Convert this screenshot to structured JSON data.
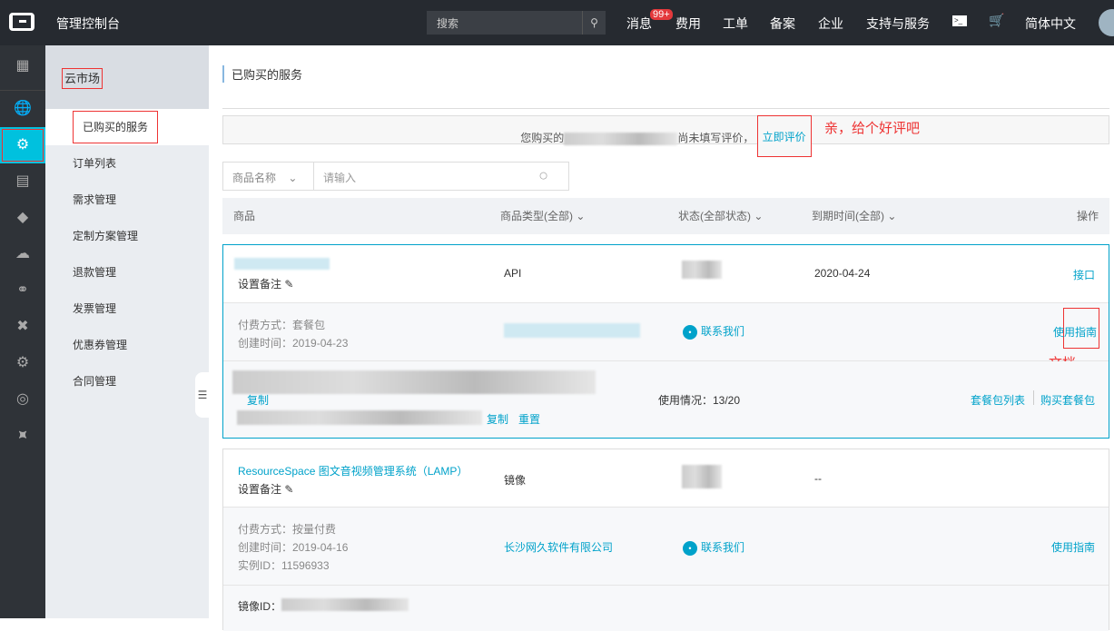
{
  "topbar": {
    "title": "管理控制台",
    "search_placeholder": "搜索",
    "badge": "99+",
    "nav": [
      "消息",
      "费用",
      "工单",
      "备案",
      "企业",
      "支持与服务",
      "简体中文"
    ],
    "terminal": ">_"
  },
  "sidebar": {
    "heading": "云市场",
    "items": [
      "已购买的服务",
      "订单列表",
      "需求管理",
      "定制方案管理",
      "退款管理",
      "发票管理",
      "优惠券管理",
      "合同管理"
    ]
  },
  "main": {
    "title": "已购买的服务",
    "notice": {
      "prefix": "您购买的",
      "suffix": "尚未填写评价，",
      "link": "立即评价",
      "annotation": "亲，给个好评吧"
    },
    "filter": {
      "select": "商品名称",
      "placeholder": "请输入"
    },
    "columns": [
      "商品",
      "商品类型(全部)",
      "状态(全部状态)",
      "到期时间(全部)",
      "操作"
    ],
    "items": [
      {
        "remark": "设置备注",
        "type": "API",
        "expire": "2020-04-24",
        "action": "接口",
        "pay": "付费方式：套餐包",
        "created": "创建时间：2019-04-23",
        "contact": "联系我们",
        "guide": "使用指南",
        "annotation": "文档",
        "copy1": "复制",
        "copy2": "复制",
        "reset": "重置",
        "usage": "使用情况：13/20",
        "pkg_list": "套餐包列表",
        "buy_pkg": "购买套餐包"
      },
      {
        "name": "ResourceSpace 图文音视频管理系统（LAMP）",
        "remark": "设置备注",
        "type": "镜像",
        "expire": "--",
        "pay": "付费方式：按量付费",
        "created": "创建时间：2019-04-16",
        "instance": "实例ID：11596933",
        "vendor": "长沙网久软件有限公司",
        "contact": "联系我们",
        "guide": "使用指南",
        "image_id": "镜像ID："
      }
    ]
  }
}
